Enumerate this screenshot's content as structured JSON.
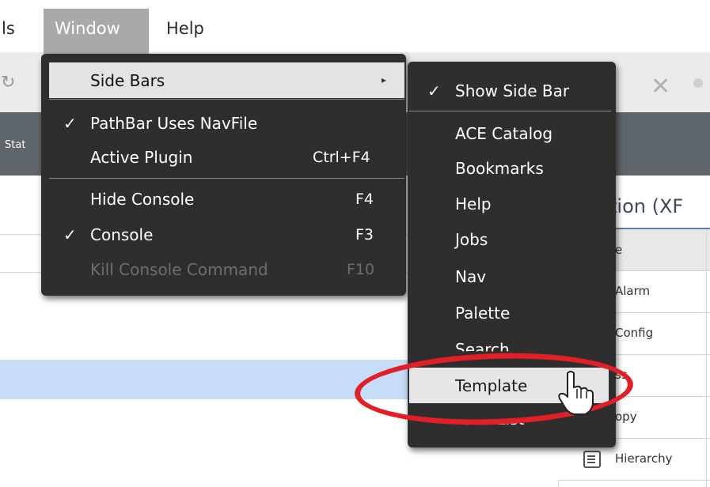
{
  "menubar": {
    "items": [
      {
        "label": "ls"
      },
      {
        "label": "Window"
      },
      {
        "label": "Help"
      }
    ]
  },
  "background": {
    "status_label": "Stat",
    "right_panel": {
      "title": "tion (XF",
      "header": "e",
      "rows": [
        "Alarm",
        "Config",
        "ss",
        "opy",
        "Hierarchy"
      ]
    }
  },
  "window_menu": {
    "items": [
      {
        "label": "Side Bars",
        "checked": false,
        "shortcut": "",
        "submenu": true,
        "highlighted": true
      },
      {
        "label": "PathBar Uses NavFile",
        "checked": true,
        "shortcut": ""
      },
      {
        "label": "Active Plugin",
        "checked": false,
        "shortcut": "Ctrl+F4"
      },
      {
        "label": "Hide Console",
        "checked": false,
        "shortcut": "F4"
      },
      {
        "label": "Console",
        "checked": true,
        "shortcut": "F3"
      },
      {
        "label": "Kill Console Command",
        "checked": false,
        "shortcut": "F10",
        "disabled": true
      }
    ],
    "check_glyph": "✓",
    "arrow_glyph": "▸"
  },
  "side_bars_menu": {
    "items": [
      {
        "label": "Show Side Bar",
        "checked": true
      },
      {
        "label": "ACE Catalog"
      },
      {
        "label": "Bookmarks"
      },
      {
        "label": "Help"
      },
      {
        "label": "Jobs"
      },
      {
        "label": "Nav"
      },
      {
        "label": "Palette"
      },
      {
        "label": "Search"
      },
      {
        "label": "Template",
        "highlighted": true
      },
      {
        "label": "Todo List"
      }
    ]
  },
  "colors": {
    "menu_bg": "#2e2e2e",
    "annotation": "#e21f26",
    "selection": "#c7dcf6"
  },
  "icons": {
    "toolbar_left": "refresh-icon",
    "toolbar_close": "close-icon",
    "cursor": "hand-pointer-icon"
  }
}
